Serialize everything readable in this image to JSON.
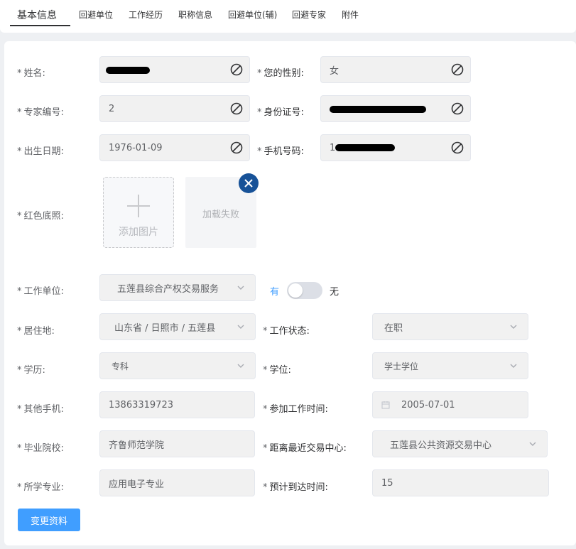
{
  "tabs": [
    {
      "label": "基本信息",
      "active": true
    },
    {
      "label": "回避单位"
    },
    {
      "label": "工作经历"
    },
    {
      "label": "职称信息"
    },
    {
      "label": "回避单位(辅)"
    },
    {
      "label": "回避专家"
    },
    {
      "label": "附件"
    }
  ],
  "form": {
    "name": {
      "label": "姓名:",
      "value": ""
    },
    "gender": {
      "label": "您的性别:",
      "value": "女"
    },
    "expert_no": {
      "label": "专家编号:",
      "value": "2"
    },
    "id_number": {
      "label": "身份证号:",
      "value": ""
    },
    "birth_date": {
      "label": "出生日期:",
      "value": "1976-01-09"
    },
    "mobile": {
      "label": "手机号码:",
      "value": "1"
    },
    "red_photo": {
      "label": "红色底照:",
      "upload_text": "添加图片",
      "failed_text": "加载失败"
    },
    "work_unit": {
      "label": "工作单位:",
      "value": "五莲县综合产权交易服务",
      "switch_on": "有",
      "switch_off": "无"
    },
    "residence": {
      "label": "居住地:",
      "value": "山东省 / 日照市 / 五莲县"
    },
    "work_status": {
      "label": "工作状态:",
      "value": "在职"
    },
    "education": {
      "label": "学历:",
      "value": "专科"
    },
    "degree": {
      "label": "学位:",
      "value": "学士学位"
    },
    "other_phone": {
      "label": "其他手机:",
      "value": "13863319723"
    },
    "work_start": {
      "label": "参加工作时间:",
      "value": "2005-07-01"
    },
    "school": {
      "label": "毕业院校:",
      "value": "齐鲁师范学院"
    },
    "nearest_center": {
      "label": "距离最近交易中心:",
      "value": "五莲县公共资源交易中心"
    },
    "major": {
      "label": "所学专业:",
      "value": "应用电子专业"
    },
    "arrival_time": {
      "label": "预计到达时间:",
      "value": "15"
    }
  },
  "required_mark": "*",
  "submit_label": "变更资料",
  "colors": {
    "primary": "#409eff",
    "close_badge": "#175298",
    "field_bg": "#f1f1f1"
  },
  "icons": [
    "disabled-icon",
    "chevron-down-icon",
    "calendar-icon",
    "close-icon",
    "plus-icon"
  ]
}
